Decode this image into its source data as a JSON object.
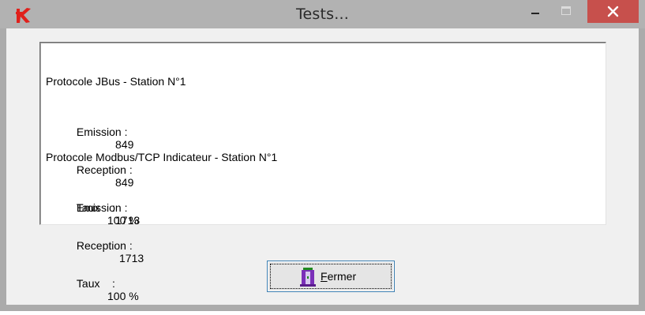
{
  "window": {
    "title": "Tests...",
    "controls": {
      "minimize_glyph": "—",
      "maximize_glyph": "☐",
      "close_glyph": "✕"
    }
  },
  "results": [
    {
      "header": "Protocole JBus - Station N°1",
      "emission_label": "Emission :",
      "emission_value": "849",
      "reception_label": "Reception :",
      "reception_value": "849",
      "rate_label": "Taux    :",
      "rate_value": "100 %"
    },
    {
      "header": "Protocole Modbus/TCP Indicateur - Station N°1",
      "emission_label": "Emission :",
      "emission_value": "1713",
      "reception_label": "Reception :",
      "reception_value": "1713",
      "rate_label": "Taux    :",
      "rate_value": "100 %"
    }
  ],
  "close_button": {
    "mnemonic": "F",
    "label_rest": "ermer"
  },
  "colors": {
    "titlebar": "#b2b2b2",
    "close_button": "#c7504c",
    "app_icon": "#e0201b",
    "client_bg": "#f0f0f0"
  },
  "icons": {
    "app": "app-logo-icon",
    "close_button": "exit-door-icon"
  }
}
